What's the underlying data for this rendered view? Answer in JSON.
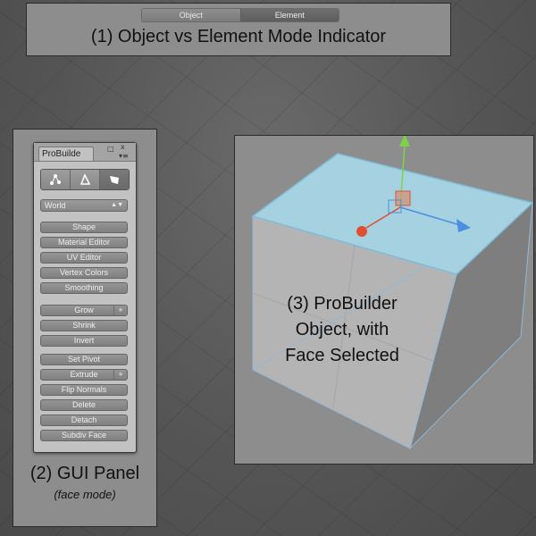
{
  "mode_indicator": {
    "object_label": "Object",
    "element_label": "Element",
    "caption": "(1) Object vs Element Mode Indicator"
  },
  "gui_panel": {
    "tab_title": "ProBuilde",
    "coordinate_space": "World",
    "mode_icons": [
      "vertex-mode-icon",
      "edge-mode-icon",
      "face-mode-icon"
    ],
    "active_mode_icon": "face-mode-icon",
    "buttons": {
      "shape": "Shape",
      "material_editor": "Material Editor",
      "uv_editor": "UV Editor",
      "vertex_colors": "Vertex Colors",
      "smoothing": "Smoothing",
      "grow": "Grow",
      "shrink": "Shrink",
      "invert": "Invert",
      "set_pivot": "Set Pivot",
      "extrude": "Extrude",
      "flip_normals": "Flip Normals",
      "delete": "Delete",
      "detach": "Detach",
      "subdiv_face": "Subdiv Face"
    },
    "plus_symbol": "+",
    "caption": "(2) GUI Panel",
    "subcaption": "(face mode)"
  },
  "cube_view": {
    "caption_lines": [
      "(3) ProBuilder",
      "Object, with",
      "Face Selected"
    ],
    "selected_face_color": "#a8d8ea",
    "axis_colors": {
      "x": "#4a8fe0",
      "y": "#7cd34a",
      "z": "#e05030"
    }
  }
}
